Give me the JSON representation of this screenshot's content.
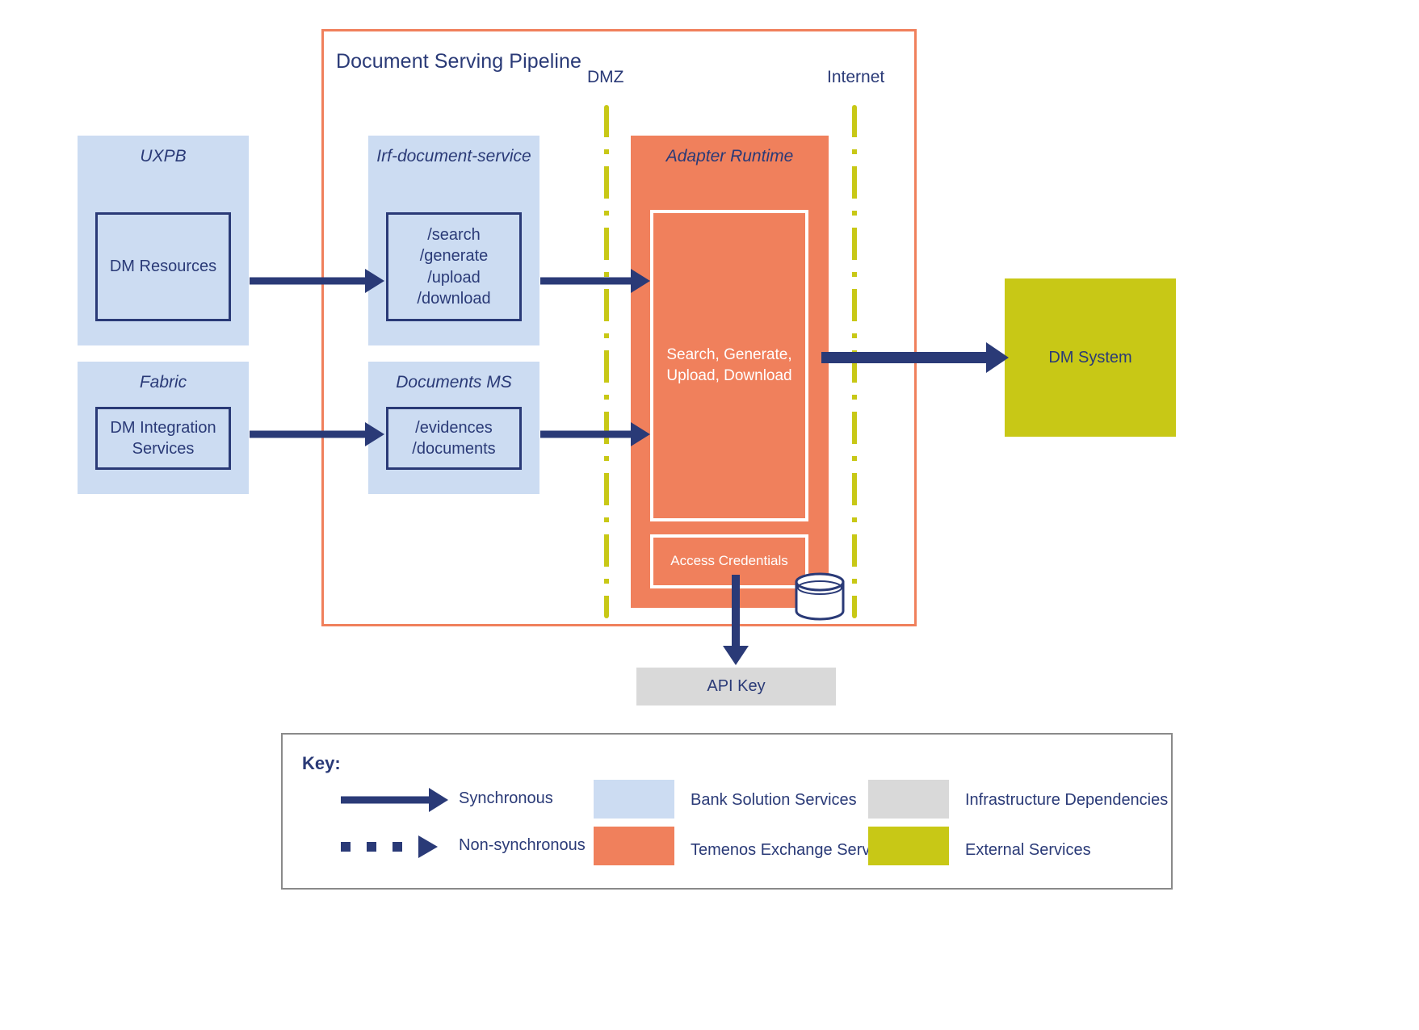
{
  "diagram": {
    "title": "Document Serving Pipeline",
    "zones": [
      {
        "name": "DMZ",
        "label": "DMZ"
      },
      {
        "name": "Internet",
        "label": "Internet"
      }
    ],
    "groups": [
      {
        "id": "uxpb",
        "title": "UXPB",
        "category": "Bank Solution Services",
        "color": "#ccdcf2",
        "inner": [
          {
            "label": "DM Resources"
          }
        ]
      },
      {
        "id": "fabric",
        "title": "Fabric",
        "category": "Bank Solution Services",
        "color": "#ccdcf2",
        "inner": [
          {
            "label": "DM Integration\nServices"
          }
        ]
      },
      {
        "id": "irf-document-service",
        "title": "Irf-document-service",
        "category": "Bank Solution Services",
        "color": "#ccdcf2",
        "inner": [
          {
            "label": "/search\n/generate\n/upload\n/download"
          }
        ]
      },
      {
        "id": "documents-ms",
        "title": "Documents MS",
        "category": "Bank Solution Services",
        "color": "#ccdcf2",
        "inner": [
          {
            "label": "/evidences\n/documents"
          }
        ]
      },
      {
        "id": "adapter-runtime",
        "title": "Adapter Runtime",
        "category": "Temenos Exchange Services",
        "color": "#f0805c",
        "inner": [
          {
            "label": "Search, Generate,\nUpload, Download"
          },
          {
            "label": "Access Credentials"
          }
        ]
      }
    ],
    "external": {
      "label": "DM System",
      "color": "#c8c816"
    },
    "infrastructure": {
      "label": "API Key",
      "color": "#d9d9d9"
    },
    "datastore": {
      "label": "credentials-store"
    }
  },
  "legend": {
    "title": "Key:",
    "entries": [
      {
        "type": "arrow-solid",
        "label": "Synchronous"
      },
      {
        "type": "arrow-dashed",
        "label": "Non-synchronous"
      },
      {
        "type": "swatch",
        "color": "#ccdcf2",
        "label": "Bank Solution Services"
      },
      {
        "type": "swatch",
        "color": "#f0805c",
        "label": "Temenos Exchange Services"
      },
      {
        "type": "swatch",
        "color": "#d9d9d9",
        "label": "Infrastructure Dependencies"
      },
      {
        "type": "swatch",
        "color": "#c8c816",
        "label": "External Services"
      }
    ]
  },
  "colors": {
    "navy": "#2a3a77",
    "bank_blue": "#ccdcf2",
    "temenos_orange": "#f0805c",
    "infrastructure_grey": "#d9d9d9",
    "external_olive": "#c8c816",
    "boundary_line": "#c8c816",
    "legend_border": "#8a8a8a"
  }
}
